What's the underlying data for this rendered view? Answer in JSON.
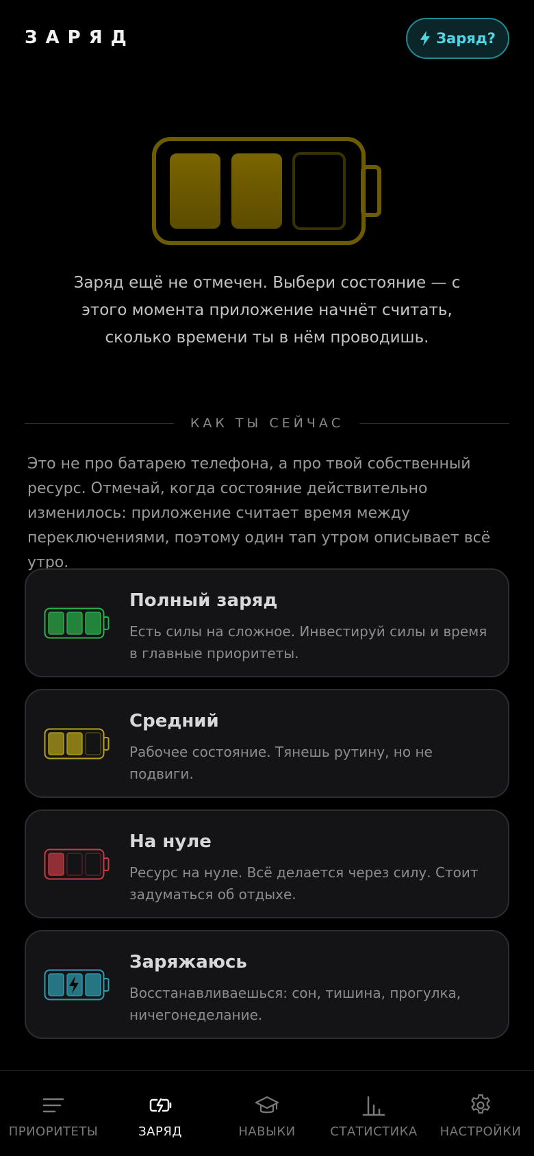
{
  "header": {
    "title": "ЗАРЯД",
    "help_button": "Заряд?"
  },
  "hero": {
    "message": "Заряд ещё не отмечен. Выбери состояние — с этого момента приложение начнёт считать, сколько времени ты в нём проводишь."
  },
  "section": {
    "title": "КАК ТЫ СЕЙЧАС",
    "description": "Это не про батарею телефона, а про твой собственный ресурс. Отмечай, когда состояние действительно изменилось: приложение считает время между переключениями, поэтому один тап утром описывает всё утро."
  },
  "states": [
    {
      "title": "Полный заряд",
      "text": "Есть силы на сложное. Инвестируй силы и время в главные приоритеты.",
      "color": "#2bb24c",
      "level": 3,
      "icon": "battery-full-icon"
    },
    {
      "title": "Средний",
      "text": "Рабочее состояние. Тянешь рутину, но не подвиги.",
      "color": "#b8a21a",
      "level": 2,
      "icon": "battery-medium-icon"
    },
    {
      "title": "На нуле",
      "text": "Ресурс на нуле. Всё делается через силу. Стоит задуматься об отдыхе.",
      "color": "#c83a44",
      "level": 1,
      "icon": "battery-empty-icon"
    },
    {
      "title": "Заряжаюсь",
      "text": "Восстанавливаешься: сон, тишина, прогулка, ничегонеделание.",
      "color": "#2e9eb0",
      "level": 3,
      "icon": "battery-charging-icon"
    }
  ],
  "nav": [
    {
      "label": "ПРИОРИТЕТЫ",
      "icon": "list-icon",
      "active": false
    },
    {
      "label": "ЗАРЯД",
      "icon": "battery-charging-icon",
      "active": true
    },
    {
      "label": "НАВЫКИ",
      "icon": "graduation-cap-icon",
      "active": false
    },
    {
      "label": "СТАТИСТИКА",
      "icon": "bar-chart-icon",
      "active": false
    },
    {
      "label": "НАСТРОЙКИ",
      "icon": "gear-icon",
      "active": false
    }
  ],
  "colors": {
    "accent": "#4fd6e6",
    "hero_battery": "#8a7400"
  }
}
